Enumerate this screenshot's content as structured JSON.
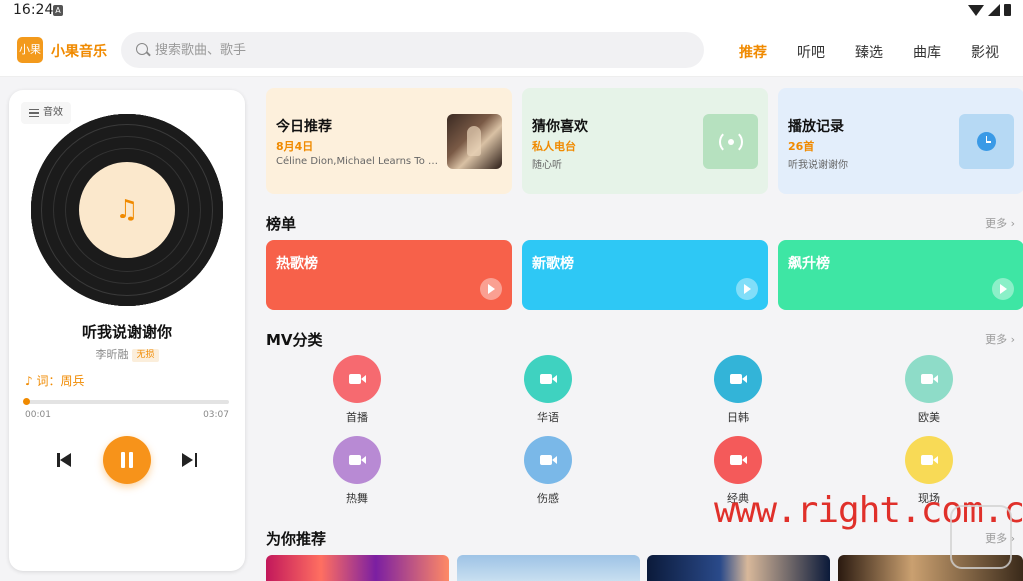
{
  "status_bar": {
    "time": "16:24",
    "notification_letter": "A"
  },
  "header": {
    "logo_text": "小果",
    "app_name": "小果音乐",
    "search_placeholder": "搜索歌曲、歌手",
    "nav": [
      {
        "label": "推荐",
        "active": true
      },
      {
        "label": "听吧",
        "active": false
      },
      {
        "label": "臻选",
        "active": false
      },
      {
        "label": "曲库",
        "active": false
      },
      {
        "label": "影视",
        "active": false
      }
    ]
  },
  "player": {
    "effect_label": "音效",
    "song_title": "听我说谢谢你",
    "artist": "李昕融",
    "quality_badge": "无损",
    "lyric_credit": "♪ 词：周兵",
    "progress_fraction": 0.005,
    "current_time": "00:01",
    "total_time": "03:07",
    "accent_color": "#f7931a"
  },
  "top_cards": [
    {
      "title": "今日推荐",
      "subtitle": "8月4日",
      "desc": "Céline Dion,Michael Learns To R...",
      "bg": "#fdf0dc",
      "thumb": "album-cover"
    },
    {
      "title": "猜你喜欢",
      "subtitle": "私人电台",
      "desc": "随心听",
      "bg": "#e6f3e8",
      "thumb": "radio-icon"
    },
    {
      "title": "播放记录",
      "subtitle": "26首",
      "desc": "听我说谢谢你",
      "bg": "#e3eefb",
      "thumb": "clock-icon"
    }
  ],
  "charts_section": {
    "title": "榜单",
    "more": "更多 ›",
    "items": [
      {
        "label": "热歌榜",
        "color": "#f7614a"
      },
      {
        "label": "新歌榜",
        "color": "#2ec8f5"
      },
      {
        "label": "飙升榜",
        "color": "#3ee6a4"
      }
    ]
  },
  "mv_section": {
    "title": "MV分类",
    "more": "更多 ›",
    "items": [
      {
        "label": "首播",
        "color": "#f66a70"
      },
      {
        "label": "华语",
        "color": "#3fd2c0"
      },
      {
        "label": "日韩",
        "color": "#33b4d8"
      },
      {
        "label": "欧美",
        "color": "#8edcc8"
      },
      {
        "label": "热舞",
        "color": "#b88ad4"
      },
      {
        "label": "伤感",
        "color": "#7ab8e8"
      },
      {
        "label": "经典",
        "color": "#f45a5a"
      },
      {
        "label": "现场",
        "color": "#f8da56"
      }
    ]
  },
  "recommend_section": {
    "title": "为你推荐",
    "more": "更多 ›"
  },
  "watermark": {
    "text": "www.right.com.cn",
    "logo_text": "恩山\nright.cn"
  }
}
